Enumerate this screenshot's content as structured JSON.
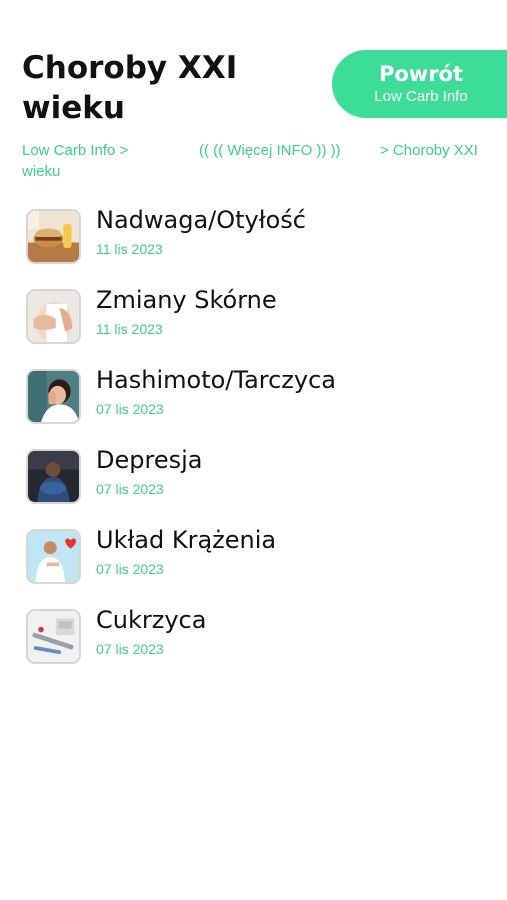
{
  "header": {
    "title": "Choroby XXI wieku",
    "back_button": {
      "label": "Powrót",
      "sublabel": "Low Carb Info"
    }
  },
  "breadcrumb": {
    "home": "Low Carb Info >",
    "home_wrap": "wieku",
    "more": "(( ((   Więcej INFO   )) ))",
    "current": "> Choroby XXI"
  },
  "articles": [
    {
      "title": "Nadwaga/Otyłość",
      "date": "11 lis 2023",
      "thumb_icon": "weight-food-thumbnail"
    },
    {
      "title": "Zmiany Skórne",
      "date": "11 lis 2023",
      "thumb_icon": "skin-thumbnail"
    },
    {
      "title": "Hashimoto/Tarczyca",
      "date": "07 lis 2023",
      "thumb_icon": "thyroid-thumbnail"
    },
    {
      "title": "Depresja",
      "date": "07 lis 2023",
      "thumb_icon": "depression-thumbnail"
    },
    {
      "title": "Układ Krążenia",
      "date": "07 lis 2023",
      "thumb_icon": "heart-thumbnail"
    },
    {
      "title": "Cukrzyca",
      "date": "07 lis 2023",
      "thumb_icon": "diabetes-thumbnail"
    }
  ],
  "colors": {
    "accent": "#3ddc97",
    "accent_text": "#3ccf8e",
    "text": "#111111"
  }
}
